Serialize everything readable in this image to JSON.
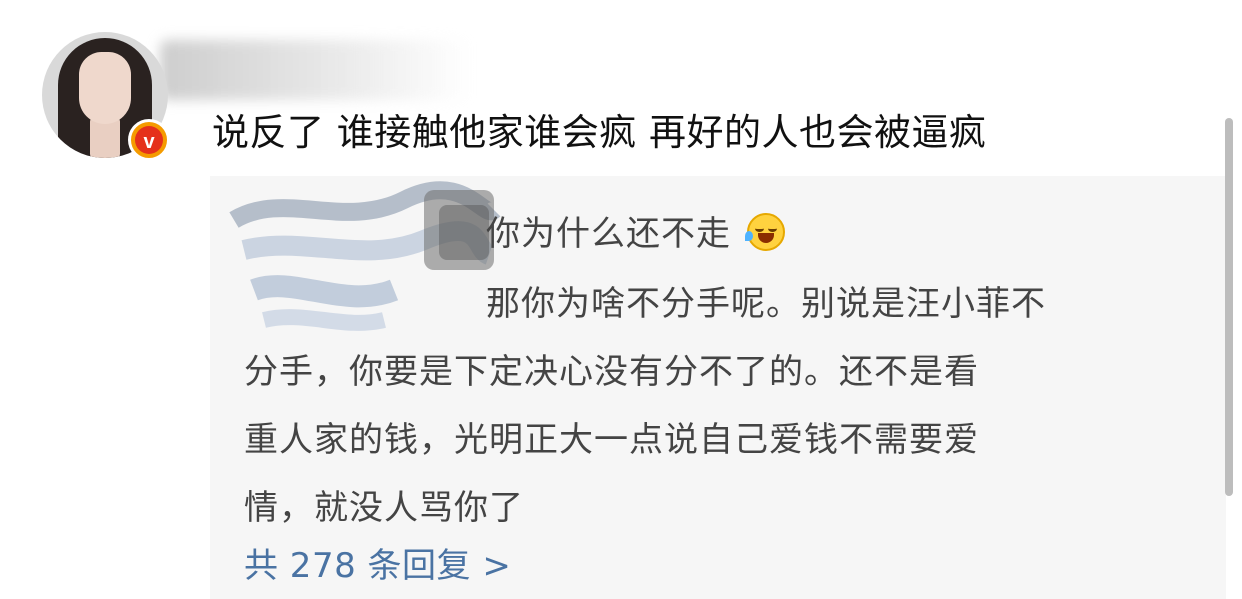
{
  "comment": {
    "text": "说反了 谁接触他家谁会疯 再好的人也会被逼疯",
    "verified_badge_letter": "v"
  },
  "replies": {
    "line1": "你为什么还不走",
    "line1_emoji": "laughing-crying-emoji",
    "line2": "那你为啥不分手呢。别说是汪小菲不",
    "line3": "分手，你要是下定决心没有分不了的。还不是看",
    "line4": "重人家的钱，光明正大一点说自己爱钱不需要爱",
    "line5": "情，就没人骂你了",
    "more_link": "共 278 条回复 >"
  },
  "colors": {
    "link": "#4a73a3",
    "reply_bg": "#f6f6f6",
    "badge": "#f59b00"
  }
}
